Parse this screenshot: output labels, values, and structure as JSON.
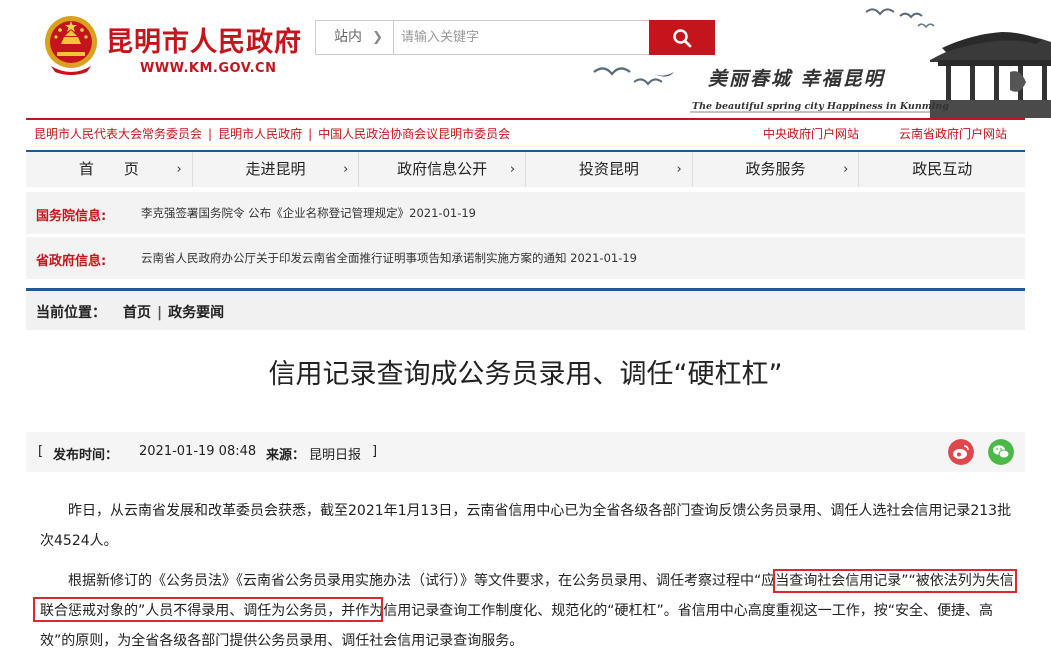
{
  "header": {
    "site_title": "昆明市人民政府",
    "site_url": "WWW.KM.GOV.CN",
    "slogan_cn": "美丽春城  幸福昆明",
    "slogan_en": "The beautiful spring city  Happiness in Kunming"
  },
  "search": {
    "scope": "站内",
    "placeholder": "请输入关键字"
  },
  "links": {
    "left": [
      "昆明市人民代表大会常务委员会",
      "昆明市人民政府",
      "中国人民政治协商会议昆明市委员会"
    ],
    "right": [
      "中央政府门户网站",
      "云南省政府门户网站"
    ]
  },
  "nav": [
    "首　　页",
    "走进昆明",
    "政府信息公开",
    "投资昆明",
    "政务服务",
    "政民互动"
  ],
  "info": {
    "state_label": "国务院信息:",
    "state_text": "李克强签署国务院令 公布《企业名称登记管理规定》2021-01-19",
    "province_label": "省政府信息:",
    "province_text": "云南省人民政府办公厅关于印发云南省全面推行证明事项告知承诺制实施方案的通知 2021-01-19"
  },
  "location": {
    "label": "当前位置：",
    "home": "首页",
    "section": "政务要闻"
  },
  "article": {
    "title": "信用记录查询成公务员录用、调任“硬杠杠”",
    "meta_open": "[",
    "publish_label": "发布时间：",
    "publish_time": "2021-01-19 08:48",
    "source_label": "来源：",
    "source": "昆明日报",
    "meta_close": "]",
    "p1": "昨日，从云南省发展和改革委员会获悉，截至2021年1月13日，云南省信用中心已为全省各级各部门查询反馈公务员录用、调任人选社会信用记录213批次4524人。",
    "p2": "根据新修订的《公务员法》《云南省公务员录用实施办法（试行）》等文件要求，在公务员录用、调任考察过程中“应当查询社会信用记录”“被依法列为失信联合惩戒对象的”人员不得录用、调任为公务员，并作为信用记录查询工作制度化、规范化的“硬杠杠”。省信用中心高度重视这一工作，按“安全、便捷、高效”的原则，为全省各级各部门提供公务员录用、调任社会信用记录查询服务。"
  },
  "share": {
    "weibo_icon": "weibo-icon",
    "wechat_icon": "wechat-icon"
  },
  "colors": {
    "brand_red": "#c4151c",
    "nav_blue": "#1a5a96",
    "highlight_red": "#e0262f"
  }
}
